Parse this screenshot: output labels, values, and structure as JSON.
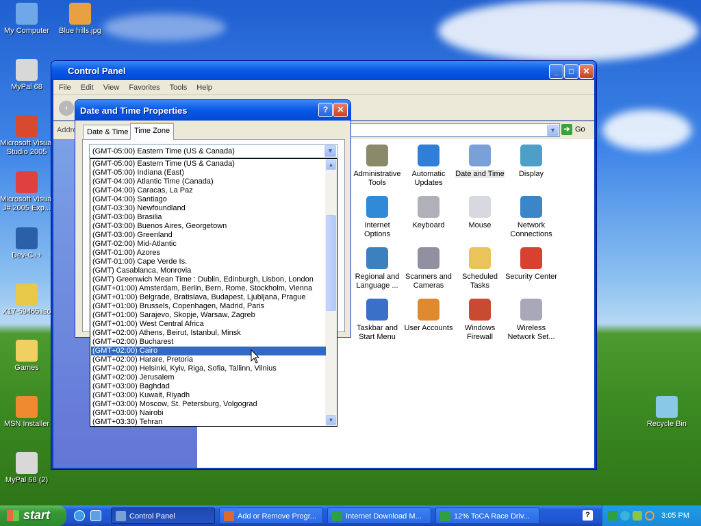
{
  "desktop_icons": [
    {
      "name": "my-computer",
      "label": "My Computer"
    },
    {
      "name": "blue-hills",
      "label": "Blue hills.jpg"
    },
    {
      "name": "mypal-68",
      "label": "MyPal 68"
    },
    {
      "name": "ms-visual-studio",
      "label": "Microsoft Visual Studio 2005"
    },
    {
      "name": "ms-visual-jsharp",
      "label": "Microsoft Visual J# 2005 Exp..."
    },
    {
      "name": "dev-cpp",
      "label": "Dev-C++"
    },
    {
      "name": "x17-iso",
      "label": "X17-59465.iso"
    },
    {
      "name": "games",
      "label": "Games"
    },
    {
      "name": "msn-installer",
      "label": "MSN Installer"
    },
    {
      "name": "mypal-68-2",
      "label": "MyPal 68 (2)"
    },
    {
      "name": "recycle-bin",
      "label": "Recycle Bin"
    }
  ],
  "control_panel": {
    "title": "Control Panel",
    "menu": [
      "File",
      "Edit",
      "View",
      "Favorites",
      "Tools",
      "Help"
    ],
    "address_label": "Addre",
    "go_label": "Go",
    "items": [
      {
        "name": "administrative-tools",
        "label": "Administrative Tools",
        "color": "#8a8a6a"
      },
      {
        "name": "automatic-updates",
        "label": "Automatic Updates",
        "color": "#2f7fd8"
      },
      {
        "name": "date-and-time",
        "label": "Date and Time",
        "color": "#7aa0d8"
      },
      {
        "name": "display",
        "label": "Display",
        "color": "#4ca0c8"
      },
      {
        "name": "internet-options",
        "label": "Internet Options",
        "color": "#2f8ad8"
      },
      {
        "name": "keyboard",
        "label": "Keyboard",
        "color": "#b0b0b8"
      },
      {
        "name": "mouse",
        "label": "Mouse",
        "color": "#d8d8e0"
      },
      {
        "name": "network-connections",
        "label": "Network Connections",
        "color": "#3a86c8"
      },
      {
        "name": "regional-language",
        "label": "Regional and Language ...",
        "color": "#3c80c0"
      },
      {
        "name": "scanners-cameras",
        "label": "Scanners and Cameras",
        "color": "#9090a0"
      },
      {
        "name": "scheduled-tasks",
        "label": "Scheduled Tasks",
        "color": "#e8c45a"
      },
      {
        "name": "security-center",
        "label": "Security Center",
        "color": "#d84030"
      },
      {
        "name": "taskbar-start-menu",
        "label": "Taskbar and Start Menu",
        "color": "#3a70c8"
      },
      {
        "name": "user-accounts",
        "label": "User Accounts",
        "color": "#e08a30"
      },
      {
        "name": "windows-firewall",
        "label": "Windows Firewall",
        "color": "#c84a30"
      },
      {
        "name": "wireless-network",
        "label": "Wireless Network Set...",
        "color": "#a8a8b8"
      }
    ]
  },
  "dialog": {
    "title": "Date and Time Properties",
    "tabs": [
      "Date & Time",
      "Time Zone"
    ],
    "selected_zone": "(GMT-05:00) Eastern Time (US & Canada)",
    "zones": [
      "(GMT-05:00) Eastern Time (US & Canada)",
      "(GMT-05:00) Indiana (East)",
      "(GMT-04:00) Atlantic Time (Canada)",
      "(GMT-04:00) Caracas, La Paz",
      "(GMT-04:00) Santiago",
      "(GMT-03:30) Newfoundland",
      "(GMT-03:00) Brasilia",
      "(GMT-03:00) Buenos Aires, Georgetown",
      "(GMT-03:00) Greenland",
      "(GMT-02:00) Mid-Atlantic",
      "(GMT-01:00) Azores",
      "(GMT-01:00) Cape Verde Is.",
      "(GMT) Casablanca, Monrovia",
      "(GMT) Greenwich Mean Time : Dublin, Edinburgh, Lisbon, London",
      "(GMT+01:00) Amsterdam, Berlin, Bern, Rome, Stockholm, Vienna",
      "(GMT+01:00) Belgrade, Bratislava, Budapest, Ljubljana, Prague",
      "(GMT+01:00) Brussels, Copenhagen, Madrid, Paris",
      "(GMT+01:00) Sarajevo, Skopje, Warsaw, Zagreb",
      "(GMT+01:00) West Central Africa",
      "(GMT+02:00) Athens, Beirut, Istanbul, Minsk",
      "(GMT+02:00) Bucharest",
      "(GMT+02:00) Cairo",
      "(GMT+02:00) Harare, Pretoria",
      "(GMT+02:00) Helsinki, Kyiv, Riga, Sofia, Tallinn, Vilnius",
      "(GMT+02:00) Jerusalem",
      "(GMT+03:00) Baghdad",
      "(GMT+03:00) Kuwait, Riyadh",
      "(GMT+03:00) Moscow, St. Petersburg, Volgograd",
      "(GMT+03:00) Nairobi",
      "(GMT+03:30) Tehran"
    ],
    "highlighted_zone": "(GMT+02:00) Cairo"
  },
  "taskbar": {
    "start_label": "start",
    "tasks": [
      {
        "name": "control-panel",
        "label": "Control Panel",
        "active": true,
        "color": "#7aa0d8"
      },
      {
        "name": "add-remove-programs",
        "label": "Add or Remove Progr...",
        "active": false,
        "color": "#d86a30"
      },
      {
        "name": "internet-download-manager",
        "label": "Internet Download M...",
        "active": false,
        "color": "#2ea040"
      },
      {
        "name": "toca-race-driver",
        "label": "12% ToCA Race Driv...",
        "active": false,
        "color": "#2ea040"
      }
    ],
    "clock": "3:05 PM"
  },
  "colors": {
    "selection": "#316ac5",
    "title_blue": "#0a5be6"
  }
}
